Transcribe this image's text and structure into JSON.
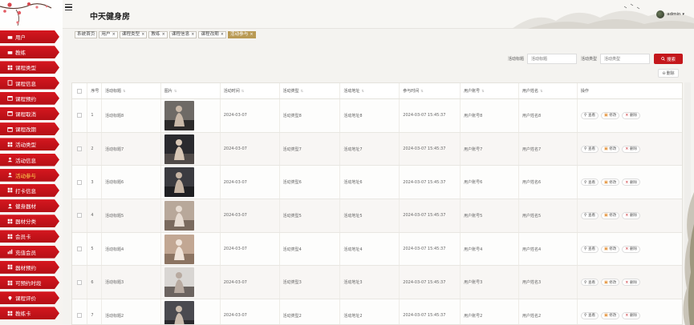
{
  "header": {
    "title": "中天健身房",
    "user_name": "admin"
  },
  "sidebar": {
    "items": [
      {
        "label": "用户",
        "icon": "user-icon",
        "active": false
      },
      {
        "label": "教练",
        "icon": "user-icon",
        "active": false
      },
      {
        "label": "课程类型",
        "icon": "grid-icon",
        "active": false
      },
      {
        "label": "课程信息",
        "icon": "book-icon",
        "active": false
      },
      {
        "label": "课程预约",
        "icon": "calendar-icon",
        "active": false
      },
      {
        "label": "课程取消",
        "icon": "calendar-icon",
        "active": false
      },
      {
        "label": "课程改期",
        "icon": "calendar-icon",
        "active": false
      },
      {
        "label": "活动类型",
        "icon": "grid-icon",
        "active": false
      },
      {
        "label": "活动信息",
        "icon": "person-icon",
        "active": false
      },
      {
        "label": "活动参与",
        "icon": "person-icon",
        "active": true
      },
      {
        "label": "打卡信息",
        "icon": "grid-icon",
        "active": false
      },
      {
        "label": "健身器材",
        "icon": "person-icon",
        "active": false
      },
      {
        "label": "器材分类",
        "icon": "grid-icon",
        "active": false
      },
      {
        "label": "会员卡",
        "icon": "grid-icon",
        "active": false
      },
      {
        "label": "充值会员",
        "icon": "chart-icon",
        "active": false
      },
      {
        "label": "器材预约",
        "icon": "grid-icon",
        "active": false
      },
      {
        "label": "可预约时段",
        "icon": "grid-icon",
        "active": false
      },
      {
        "label": "课程评价",
        "icon": "location-icon",
        "active": false
      },
      {
        "label": "教练卡",
        "icon": "grid-icon",
        "active": false
      }
    ]
  },
  "tabs": [
    {
      "label": "系统首页",
      "closable": false,
      "active": false
    },
    {
      "label": "用户",
      "closable": true,
      "active": false
    },
    {
      "label": "课程类型",
      "closable": true,
      "active": false
    },
    {
      "label": "教练",
      "closable": true,
      "active": false
    },
    {
      "label": "课程信息",
      "closable": true,
      "active": false
    },
    {
      "label": "课程改期",
      "closable": true,
      "active": false
    },
    {
      "label": "活动参与",
      "closable": true,
      "active": true
    }
  ],
  "search": {
    "title_label": "活动标题",
    "title_placeholder": "活动标题",
    "type_label": "活动类型",
    "type_placeholder": "活动类型",
    "button_label": "搜索"
  },
  "toolbar": {
    "delete_label": "删除"
  },
  "table": {
    "columns": [
      "序号",
      "活动标题",
      "图片",
      "活动时间",
      "活动类型",
      "活动地址",
      "参与时间",
      "用户账号",
      "用户姓名",
      "操作"
    ],
    "rows": [
      {
        "idx": "1",
        "title": "活动标题8",
        "time": "2024-03-07",
        "type": "活动类型8",
        "addr": "活动地址8",
        "join": "2024-03-07 15:45:37",
        "account": "用户账号8",
        "name": "用户姓名8",
        "img": "photo-gym-1"
      },
      {
        "idx": "2",
        "title": "活动标题7",
        "time": "2024-03-07",
        "type": "活动类型7",
        "addr": "活动地址7",
        "join": "2024-03-07 15:45:37",
        "account": "用户账号7",
        "name": "用户姓名7",
        "img": "photo-gym-2"
      },
      {
        "idx": "3",
        "title": "活动标题6",
        "time": "2024-03-07",
        "type": "活动类型6",
        "addr": "活动地址6",
        "join": "2024-03-07 15:45:37",
        "account": "用户账号6",
        "name": "用户姓名6",
        "img": "photo-gym-3"
      },
      {
        "idx": "4",
        "title": "活动标题5",
        "time": "2024-03-07",
        "type": "活动类型5",
        "addr": "活动地址5",
        "join": "2024-03-07 15:45:37",
        "account": "用户账号5",
        "name": "用户姓名5",
        "img": "photo-gym-4"
      },
      {
        "idx": "5",
        "title": "活动标题4",
        "time": "2024-03-07",
        "type": "活动类型4",
        "addr": "活动地址4",
        "join": "2024-03-07 15:45:37",
        "account": "用户账号4",
        "name": "用户姓名4",
        "img": "photo-gym-5"
      },
      {
        "idx": "6",
        "title": "活动标题3",
        "time": "2024-03-07",
        "type": "活动类型3",
        "addr": "活动地址3",
        "join": "2024-03-07 15:45:37",
        "account": "用户账号3",
        "name": "用户姓名3",
        "img": "photo-gym-6"
      },
      {
        "idx": "7",
        "title": "活动标题2",
        "time": "2024-03-07",
        "type": "活动类型2",
        "addr": "活动地址2",
        "join": "2024-03-07 15:45:37",
        "account": "用户账号2",
        "name": "用户姓名2",
        "img": "photo-gym-7"
      }
    ],
    "ops": {
      "view": "查看",
      "edit": "修改",
      "delete": "删除"
    }
  },
  "colors": {
    "primary_red": "#c4171c",
    "active_tab": "#b99a54",
    "active_menu_text": "#ffd24d"
  }
}
